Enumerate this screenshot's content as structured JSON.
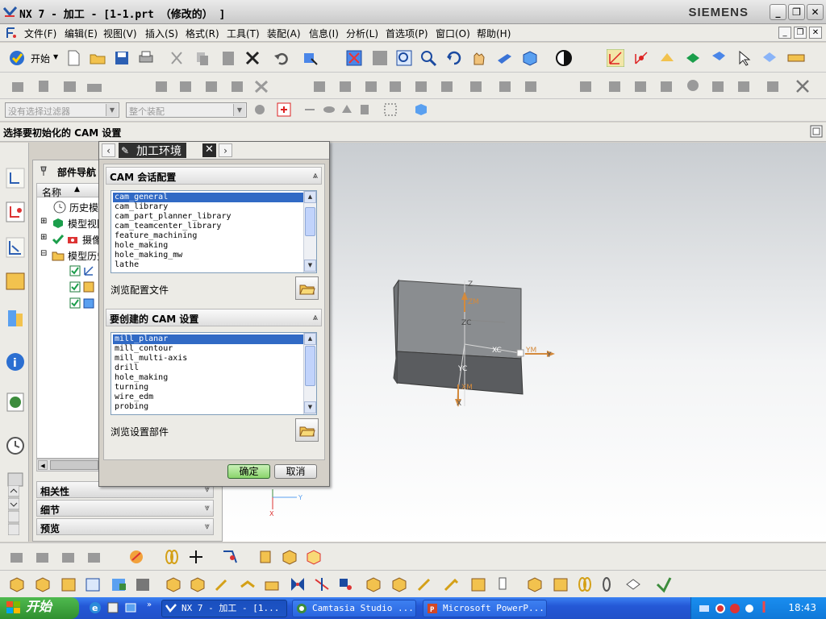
{
  "window": {
    "title": "NX 7 - 加工 - [1-1.prt （修改的）  ]",
    "brand": "SIEMENS"
  },
  "menu": {
    "items": [
      "文件(F)",
      "编辑(E)",
      "视图(V)",
      "插入(S)",
      "格式(R)",
      "工具(T)",
      "装配(A)",
      "信息(I)",
      "分析(L)",
      "首选项(P)",
      "窗口(O)",
      "帮助(H)"
    ]
  },
  "toolbar": {
    "start_label": "开始",
    "selection_filter": "没有选择过滤器",
    "assembly_scope": "整个装配"
  },
  "cue": {
    "text": "选择要初始化的 CAM 设置"
  },
  "navigator": {
    "title": "部件导航",
    "column_name": "名称",
    "tree": [
      {
        "label": "历史模式",
        "icon": "clock-icon"
      },
      {
        "label": "模型视图",
        "icon": "model-views-icon"
      },
      {
        "label": "摄像机",
        "icon": "camera-icon"
      },
      {
        "label": "模型历史",
        "icon": "folder-icon"
      }
    ],
    "panels": [
      "相关性",
      "细节",
      "预览"
    ]
  },
  "dialog": {
    "title": "加工环境",
    "section_config": "CAM 会话配置",
    "config_options": [
      "cam_general",
      "cam_library",
      "cam_part_planner_library",
      "cam_teamcenter_library",
      "feature_machining",
      "hole_making",
      "hole_making_mw",
      "lathe"
    ],
    "config_selected": "cam_general",
    "browse_config": "浏览配置文件",
    "section_setup": "要创建的 CAM 设置",
    "setup_options": [
      "mill_planar",
      "mill_contour",
      "mill_multi-axis",
      "drill",
      "hole_making",
      "turning",
      "wire_edm",
      "probing"
    ],
    "setup_selected": "mill_planar",
    "browse_setup": "浏览设置部件",
    "ok": "确定",
    "cancel": "取消"
  },
  "viewport": {
    "axis_labels": {
      "zm": "ZM",
      "zc": "ZC",
      "xc": "XC",
      "yc": "YC",
      "xm": "XM",
      "ym": "YM",
      "z": "Z",
      "x": "X",
      "y": "Y"
    }
  },
  "taskbar": {
    "start": "开始",
    "tasks": [
      "NX 7 - 加工 - [1...",
      "Camtasia Studio ...",
      "Microsoft PowerP..."
    ],
    "clock": "18:43"
  },
  "colors": {
    "selection": "#316ac5",
    "ok_button": "#8bd46c",
    "taskbar": "#2458d6",
    "block_face": "#8a8d90"
  }
}
